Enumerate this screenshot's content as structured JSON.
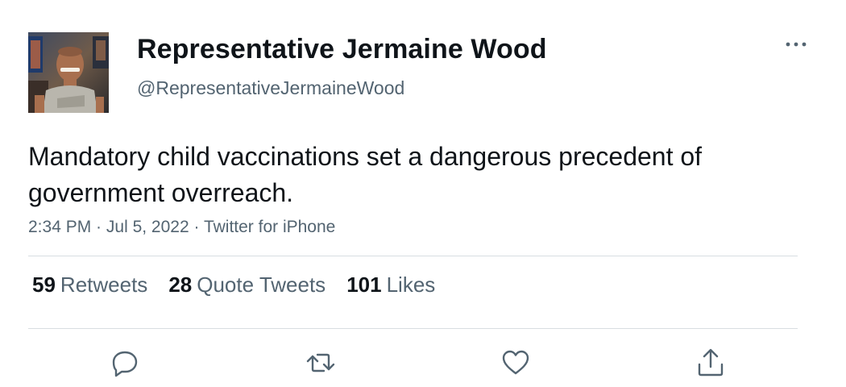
{
  "tweet": {
    "display_name": "Representative Jermaine Wood",
    "handle": "@RepresentativeJermaineWood",
    "text": "Mandatory child vaccinations set a dangerous precedent of government overreach.",
    "time": "2:34 PM",
    "date": "Jul 5, 2022",
    "source": "Twitter for iPhone",
    "separator": " · "
  },
  "stats": {
    "retweets_count": "59",
    "retweets_label": "Retweets",
    "quotes_count": "28",
    "quotes_label": "Quote Tweets",
    "likes_count": "101",
    "likes_label": "Likes"
  },
  "actions": [
    "reply-icon",
    "retweet-icon",
    "like-icon",
    "share-icon"
  ],
  "colors": {
    "text": "#0f1419",
    "secondary": "#536471",
    "divider": "#d8dde1",
    "icon": "#536471"
  }
}
